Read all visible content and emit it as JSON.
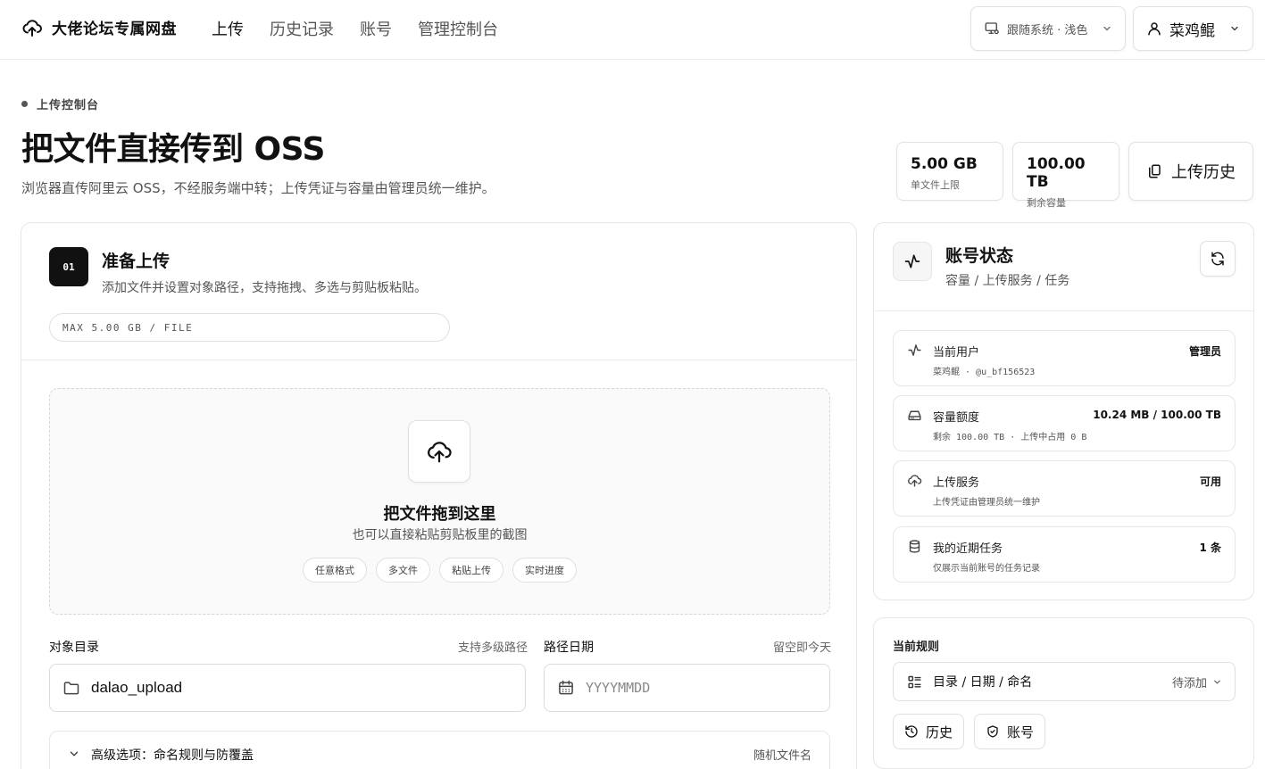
{
  "header": {
    "brand": "大佬论坛专属网盘",
    "nav": [
      "上传",
      "历史记录",
      "账号",
      "管理控制台"
    ],
    "theme_label": "跟随系统 · 浅色",
    "user_name": "菜鸡鲲"
  },
  "page": {
    "eyebrow": "上传控制台",
    "title": "把文件直接传到 OSS",
    "subtitle": "浏览器直传阿里云 OSS，不经服务端中转；上传凭证与容量由管理员统一维护。",
    "stats": [
      {
        "value": "5.00 GB",
        "label": "单文件上限"
      },
      {
        "value": "100.00 TB",
        "label": "剩余容量"
      }
    ],
    "history_button": "上传历史"
  },
  "upload": {
    "step": "01",
    "title": "准备上传",
    "subtitle": "添加文件并设置对象路径，支持拖拽、多选与剪贴板粘贴。",
    "max_pill": "MAX 5.00 GB / FILE",
    "drop_title": "把文件拖到这里",
    "drop_sub": "也可以直接粘贴剪贴板里的截图",
    "chips": [
      "任意格式",
      "多文件",
      "粘贴上传",
      "实时进度"
    ],
    "dir_label": "对象目录",
    "dir_hint": "支持多级路径",
    "dir_value": "dalao_upload",
    "date_label": "路径日期",
    "date_hint": "留空即今天",
    "date_placeholder": "YYYYMMDD",
    "advanced_label": "高级选项：命名规则与防覆盖",
    "advanced_value": "随机文件名"
  },
  "status": {
    "title": "账号状态",
    "subtitle": "容量 / 上传服务 / 任务",
    "rows": [
      {
        "title": "当前用户",
        "detail": "菜鸡鲲 · @u_bf156523",
        "right": "管理员",
        "icon": "activity-icon"
      },
      {
        "title": "容量额度",
        "detail": "剩余 100.00 TB · 上传中占用 0 B",
        "right": "10.24 MB / 100.00 TB",
        "icon": "drive-icon"
      },
      {
        "title": "上传服务",
        "detail": "上传凭证由管理员统一维护",
        "right": "可用",
        "icon": "cloud-upload-icon"
      },
      {
        "title": "我的近期任务",
        "detail": "仅展示当前账号的任务记录",
        "right": "1 条",
        "icon": "database-icon"
      }
    ]
  },
  "rules": {
    "title": "当前规则",
    "select_label": "目录 / 日期 / 命名",
    "select_status": "待添加",
    "history_button": "历史",
    "account_button": "账号"
  }
}
